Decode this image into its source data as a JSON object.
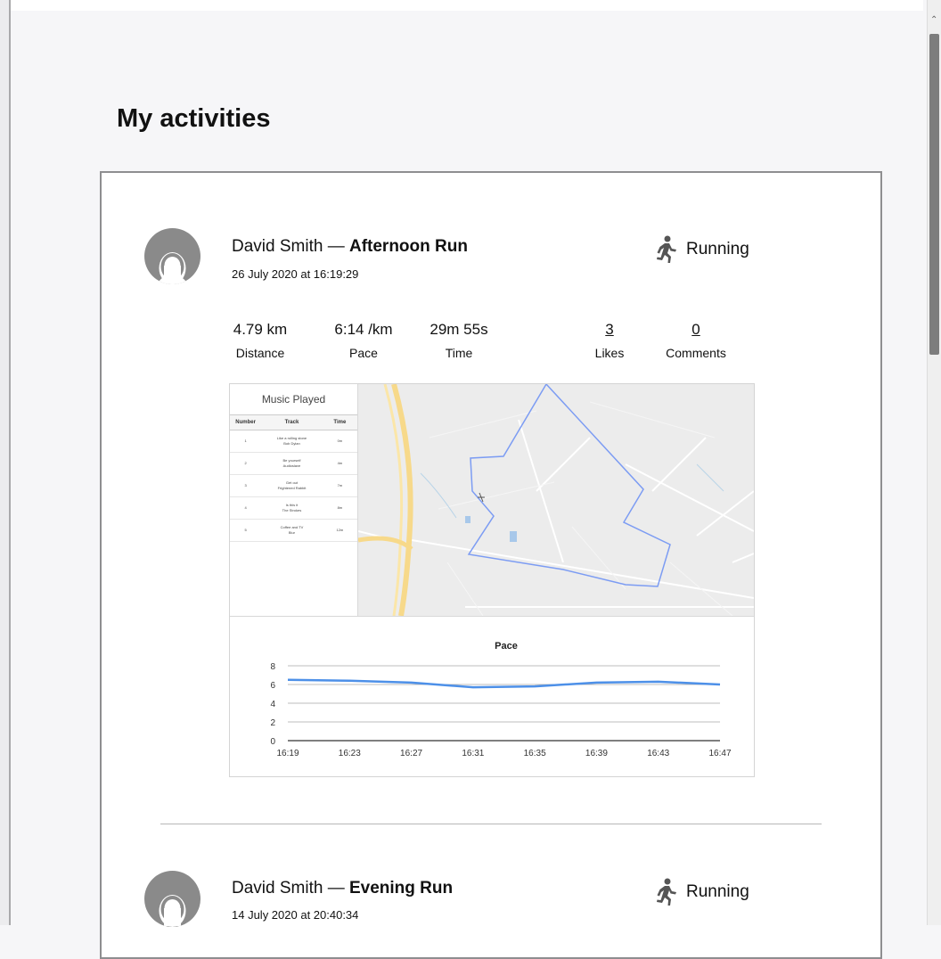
{
  "page": {
    "title": "My activities"
  },
  "activities": [
    {
      "user": "David Smith",
      "separator": "—",
      "title": "Afternoon Run",
      "date": "26 July 2020 at 16:19:29",
      "sport": "Running",
      "stats": [
        {
          "value": "4.79 km",
          "label": "Distance"
        },
        {
          "value": "6:14 /km",
          "label": "Pace"
        },
        {
          "value": "29m 55s",
          "label": "Time"
        },
        {
          "value": "3",
          "label": "Likes"
        },
        {
          "value": "0",
          "label": "Comments"
        }
      ],
      "music": {
        "title": "Music Played",
        "headers": [
          "Number",
          "Track",
          "Time"
        ],
        "rows": [
          {
            "number": "1",
            "track": "Like a rolling stone",
            "artist": "Bob Dylan",
            "time": "0m"
          },
          {
            "number": "2",
            "track": "Be yourself",
            "artist": "Audioslave",
            "time": "4m"
          },
          {
            "number": "3",
            "track": "Get out",
            "artist": "Frightened Rabbit",
            "time": "7m"
          },
          {
            "number": "4",
            "track": "Is this it",
            "artist": "The Strokes",
            "time": "8m"
          },
          {
            "number": "5",
            "track": "Coffee and TV",
            "artist": "Blur",
            "time": "12m"
          }
        ]
      }
    },
    {
      "user": "David Smith",
      "separator": "—",
      "title": "Evening Run",
      "date": "14 July 2020 at 20:40:34",
      "sport": "Running"
    }
  ],
  "colors": {
    "route": "#7c9cf3",
    "pace_line": "#4d90e8",
    "avatar": "#8a8a8a",
    "card_border": "#8e8e90"
  },
  "icons": {
    "sport": "running-person-icon",
    "avatar": "user-silhouette-icon"
  },
  "chart_data": {
    "type": "line",
    "title": "Pace",
    "categories": [
      "16:19",
      "16:23",
      "16:27",
      "16:31",
      "16:35",
      "16:39",
      "16:43",
      "16:47"
    ],
    "series": [
      {
        "values": [
          6.5,
          6.4,
          6.2,
          5.7,
          5.8,
          6.2,
          6.3,
          6.0
        ]
      }
    ],
    "ylim": [
      0,
      8
    ],
    "yticks": [
      "0",
      "2",
      "4",
      "6",
      "8"
    ],
    "grid": true
  }
}
